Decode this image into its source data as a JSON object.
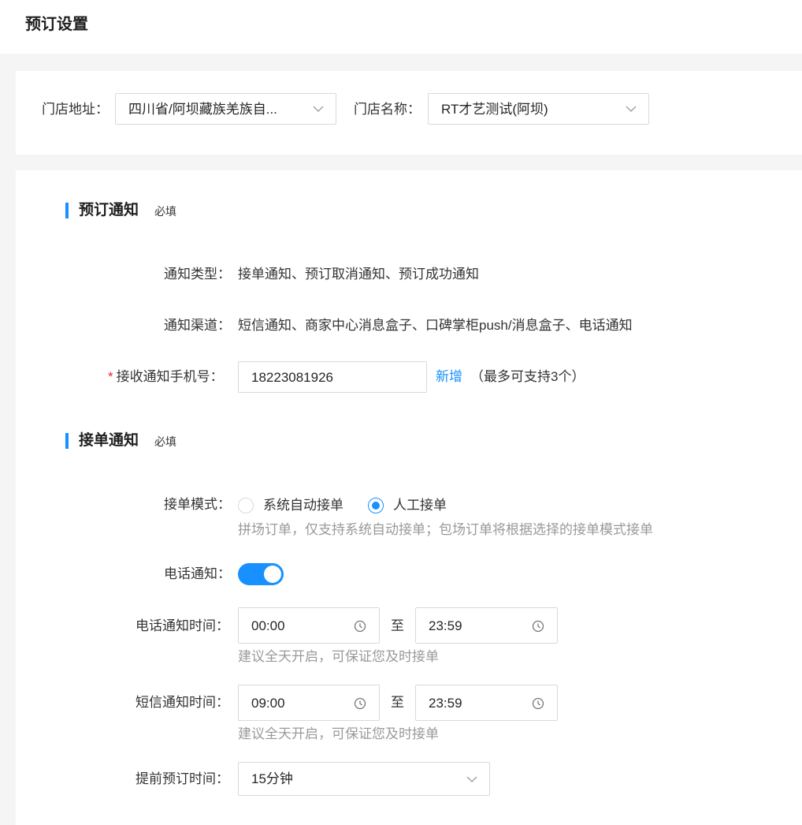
{
  "header": {
    "title": "预订设置"
  },
  "filter": {
    "address_label": "门店地址：",
    "address_value": "四川省/阿坝藏族羌族自...",
    "store_label": "门店名称：",
    "store_value": "RT才艺测试(阿坝)"
  },
  "booking_notice": {
    "title": "预订通知",
    "required_tag": "必填",
    "type_label": "通知类型：",
    "type_value": "接单通知、预订取消通知、预订成功通知",
    "channel_label": "通知渠道：",
    "channel_value": "短信通知、商家中心消息盒子、口碑掌柜push/消息盒子、电话通知",
    "phone_asterisk": "*",
    "phone_label": "接收通知手机号：",
    "phone_value": "18223081926",
    "add_link": "新增",
    "max_hint": "（最多可支持3个）"
  },
  "order_notice": {
    "title": "接单通知",
    "required_tag": "必填",
    "mode_label": "接单模式：",
    "mode_options": [
      {
        "label": "系统自动接单",
        "checked": false
      },
      {
        "label": "人工接单",
        "checked": true
      }
    ],
    "mode_hint": "拼场订单，仅支持系统自动接单；包场订单将根据选择的接单模式接单",
    "phone_notify_label": "电话通知：",
    "phone_notify_on": true,
    "phone_time_label": "电话通知时间：",
    "phone_time_start": "00:00",
    "phone_time_to": "至",
    "phone_time_end": "23:59",
    "phone_time_hint": "建议全天开启，可保证您及时接单",
    "sms_time_label": "短信通知时间：",
    "sms_time_start": "09:00",
    "sms_time_to": "至",
    "sms_time_end": "23:59",
    "sms_time_hint": "建议全天开启，可保证您及时接单",
    "advance_label": "提前预订时间：",
    "advance_value": "15分钟"
  },
  "colors": {
    "accent": "#1890ff",
    "required": "#f5222d"
  }
}
